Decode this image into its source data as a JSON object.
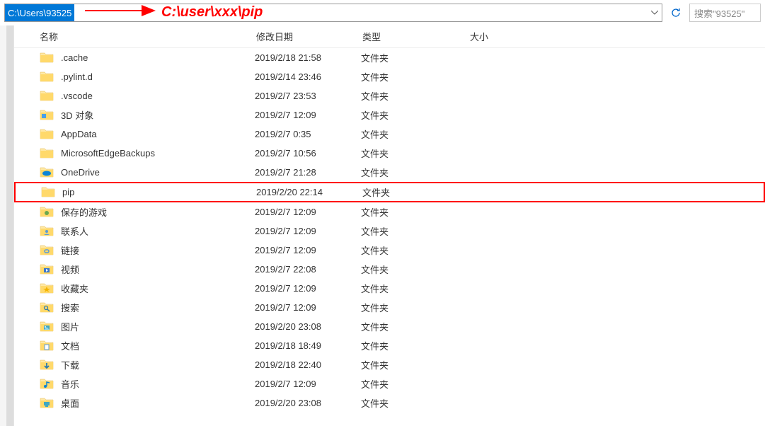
{
  "address_bar": {
    "path": "C:\\Users\\93525"
  },
  "search": {
    "placeholder": "搜索\"93525\""
  },
  "annotation": {
    "text": "C:\\user\\xxx\\pip"
  },
  "columns": {
    "name": "名称",
    "date": "修改日期",
    "type": "类型",
    "size": "大小"
  },
  "files": [
    {
      "name": ".cache",
      "date": "2019/2/18 21:58",
      "type": "文件夹",
      "icon": "folder",
      "highlighted": false
    },
    {
      "name": ".pylint.d",
      "date": "2019/2/14 23:46",
      "type": "文件夹",
      "icon": "folder",
      "highlighted": false
    },
    {
      "name": ".vscode",
      "date": "2019/2/7 23:53",
      "type": "文件夹",
      "icon": "folder",
      "highlighted": false
    },
    {
      "name": "3D 对象",
      "date": "2019/2/7 12:09",
      "type": "文件夹",
      "icon": "folder-3d",
      "highlighted": false
    },
    {
      "name": "AppData",
      "date": "2019/2/7 0:35",
      "type": "文件夹",
      "icon": "folder",
      "highlighted": false
    },
    {
      "name": "MicrosoftEdgeBackups",
      "date": "2019/2/7 10:56",
      "type": "文件夹",
      "icon": "folder",
      "highlighted": false
    },
    {
      "name": "OneDrive",
      "date": "2019/2/7 21:28",
      "type": "文件夹",
      "icon": "folder-onedrive",
      "highlighted": false
    },
    {
      "name": "pip",
      "date": "2019/2/20 22:14",
      "type": "文件夹",
      "icon": "folder",
      "highlighted": true
    },
    {
      "name": "保存的游戏",
      "date": "2019/2/7 12:09",
      "type": "文件夹",
      "icon": "folder-games",
      "highlighted": false
    },
    {
      "name": "联系人",
      "date": "2019/2/7 12:09",
      "type": "文件夹",
      "icon": "folder-contacts",
      "highlighted": false
    },
    {
      "name": "链接",
      "date": "2019/2/7 12:09",
      "type": "文件夹",
      "icon": "folder-links",
      "highlighted": false
    },
    {
      "name": "视频",
      "date": "2019/2/7 22:08",
      "type": "文件夹",
      "icon": "folder-videos",
      "highlighted": false
    },
    {
      "name": "收藏夹",
      "date": "2019/2/7 12:09",
      "type": "文件夹",
      "icon": "folder-favorites",
      "highlighted": false
    },
    {
      "name": "搜索",
      "date": "2019/2/7 12:09",
      "type": "文件夹",
      "icon": "folder-search",
      "highlighted": false
    },
    {
      "name": "图片",
      "date": "2019/2/20 23:08",
      "type": "文件夹",
      "icon": "folder-pictures",
      "highlighted": false
    },
    {
      "name": "文档",
      "date": "2019/2/18 18:49",
      "type": "文件夹",
      "icon": "folder-documents",
      "highlighted": false
    },
    {
      "name": "下载",
      "date": "2019/2/18 22:40",
      "type": "文件夹",
      "icon": "folder-downloads",
      "highlighted": false
    },
    {
      "name": "音乐",
      "date": "2019/2/7 12:09",
      "type": "文件夹",
      "icon": "folder-music",
      "highlighted": false
    },
    {
      "name": "桌面",
      "date": "2019/2/20 23:08",
      "type": "文件夹",
      "icon": "folder-desktop",
      "highlighted": false
    }
  ]
}
